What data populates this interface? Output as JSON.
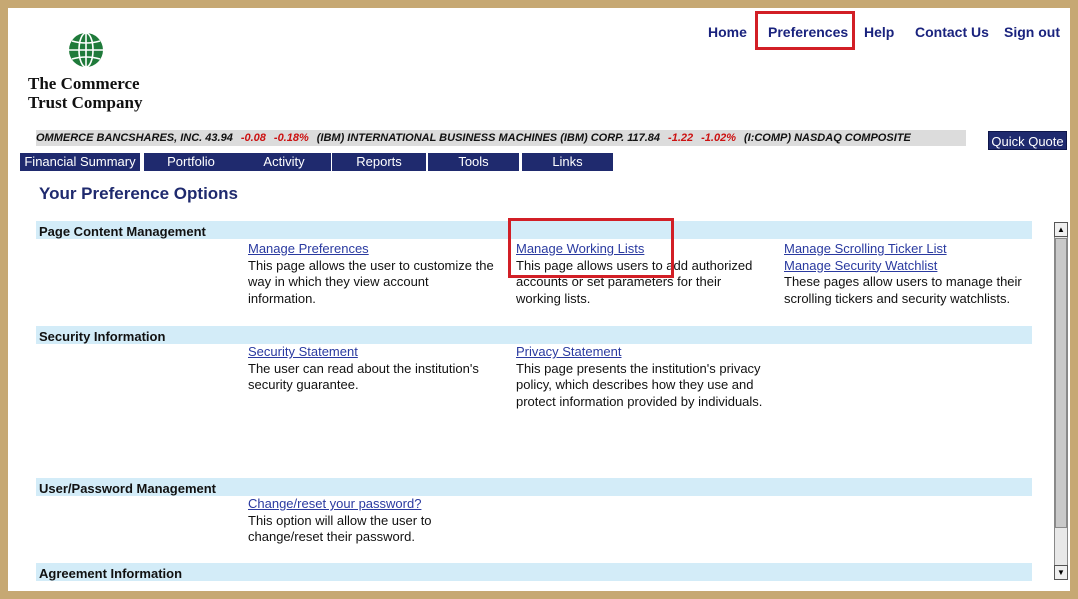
{
  "brand": {
    "line1": "The Commerce",
    "line2": "Trust Company"
  },
  "topnav": [
    {
      "label": "Home"
    },
    {
      "label": "Preferences"
    },
    {
      "label": "Help"
    },
    {
      "label": "Contact Us"
    },
    {
      "label": "Sign out"
    }
  ],
  "ticker": {
    "items": [
      {
        "text": "OMMERCE BANCSHARES, INC. 43.94",
        "kind": "i"
      },
      {
        "text": "-0.08",
        "kind": "red"
      },
      {
        "text": "-0.18%",
        "kind": "red"
      },
      {
        "text": "(IBM) INTERNATIONAL BUSINESS MACHINES (IBM) CORP. 117.84",
        "kind": "i"
      },
      {
        "text": "-1.22",
        "kind": "red"
      },
      {
        "text": "-1.02%",
        "kind": "red"
      },
      {
        "text": "(I:COMP) NASDAQ COMPOSITE",
        "kind": "i"
      }
    ],
    "quick_quote": "Quick Quote"
  },
  "tabs": [
    "Financial Summary",
    "Portfolio",
    "Activity",
    "Reports",
    "Tools",
    "Links"
  ],
  "page_title": "Your Preference Options",
  "sections": {
    "content": {
      "title": "Page Content Management",
      "col1": {
        "link": "Manage Preferences",
        "desc": "This page allows the user to customize the way in which they view account information."
      },
      "col2": {
        "link": "Manage Working Lists",
        "desc": "This page allows users to add authorized accounts or set parameters for their working lists."
      },
      "col3": {
        "link1": "Manage Scrolling Ticker List",
        "link2": "Manage Security Watchlist",
        "desc": "These pages allow users to manage their scrolling tickers and security watchlists."
      }
    },
    "security": {
      "title": "Security Information",
      "col1": {
        "link": "Security Statement",
        "desc": "The user can read about the institution's security guarantee."
      },
      "col2": {
        "link": "Privacy Statement",
        "desc": "This page presents the institution's privacy policy, which describes how they use and protect information provided by individuals."
      }
    },
    "password": {
      "title": "User/Password Management",
      "col1": {
        "link": "Change/reset your password?",
        "desc": "This option will allow the user to change/reset their password."
      }
    },
    "agreement": {
      "title": "Agreement Information"
    }
  },
  "colors": {
    "navy": "#1f2a6e",
    "highlight": "#d21f26",
    "section_bg": "#d3ecf8",
    "border_gold": "#c6a873"
  }
}
